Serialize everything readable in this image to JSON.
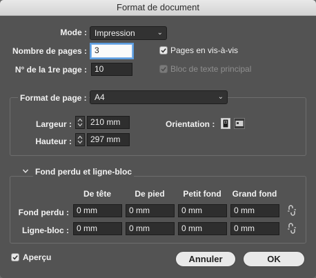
{
  "window": {
    "title": "Format de document"
  },
  "mode": {
    "label": "Mode :",
    "value": "Impression"
  },
  "pages": {
    "count_label": "Nombre de pages :",
    "count_value": "3",
    "start_label": "N° de la 1re page :",
    "start_value": "10",
    "facing_label": "Pages en vis-à-vis",
    "facing_checked": true,
    "primary_text_label": "Bloc de texte principal",
    "primary_text_checked": true,
    "primary_text_enabled": false
  },
  "page_size": {
    "label": "Format de page :",
    "value": "A4",
    "width_label": "Largeur :",
    "width_value": "210 mm",
    "height_label": "Hauteur :",
    "height_value": "297 mm",
    "orientation_label": "Orientation :",
    "orientation_selected": "portrait",
    "orientation_icons": [
      "portrait-orientation-icon",
      "landscape-orientation-icon"
    ]
  },
  "bleed_slug": {
    "title": "Fond perdu et ligne-bloc",
    "columns": [
      "De tête",
      "De pied",
      "Petit fond",
      "Grand fond"
    ],
    "rows": [
      {
        "label": "Fond perdu :",
        "values": [
          "0 mm",
          "0 mm",
          "0 mm",
          "0 mm"
        ]
      },
      {
        "label": "Ligne-bloc :",
        "values": [
          "0 mm",
          "0 mm",
          "0 mm",
          "0 mm"
        ]
      }
    ]
  },
  "footer": {
    "preview_label": "Aperçu",
    "preview_checked": true,
    "cancel_label": "Annuler",
    "ok_label": "OK"
  }
}
